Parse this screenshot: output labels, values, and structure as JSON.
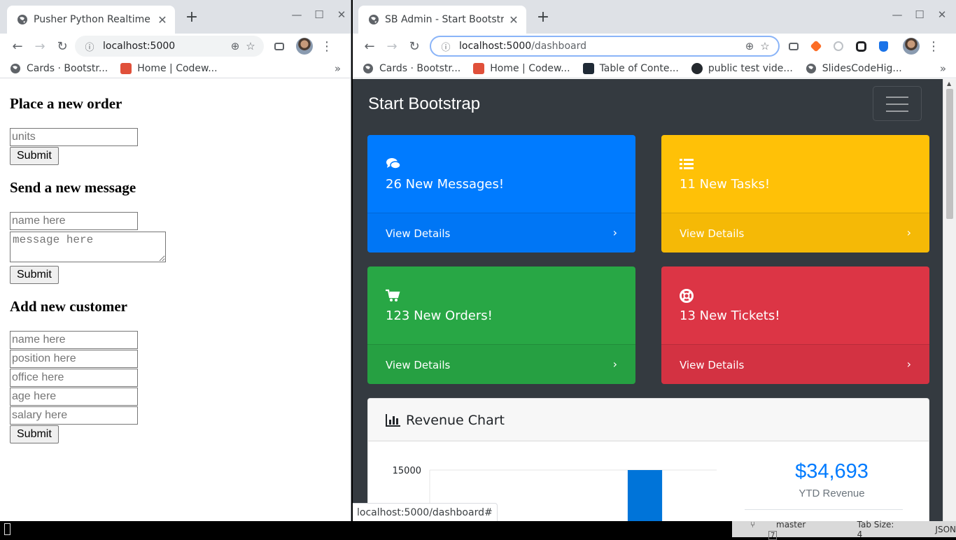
{
  "left_window": {
    "tab_title": "Pusher Python Realtime D",
    "url": "localhost:5000",
    "bookmarks": [
      "Cards · Bootstr...",
      "Home | Codew..."
    ],
    "bookmarks_more": "»",
    "form_order": {
      "heading": "Place a new order",
      "units_placeholder": "units",
      "submit": "Submit"
    },
    "form_message": {
      "heading": "Send a new message",
      "name_placeholder": "name here",
      "message_placeholder": "message here",
      "submit": "Submit"
    },
    "form_customer": {
      "heading": "Add new customer",
      "name_placeholder": "name here",
      "position_placeholder": "position here",
      "office_placeholder": "office here",
      "age_placeholder": "age here",
      "salary_placeholder": "salary here",
      "submit": "Submit"
    }
  },
  "right_window": {
    "tab_title": "SB Admin - Start Bootstrap",
    "url_host": "localhost:5000",
    "url_path": "/dashboard",
    "bookmarks": [
      "Cards · Bootstr...",
      "Home | Codew...",
      "Table of Conte...",
      "public test vide...",
      "SlidesCodeHig..."
    ],
    "bookmarks_more": "»",
    "brand": "Start Bootstrap",
    "cards": [
      {
        "text": "26 New Messages!",
        "footer": "View Details",
        "icon": "comments-icon",
        "color": "#007bff"
      },
      {
        "text": "11 New Tasks!",
        "footer": "View Details",
        "icon": "list-icon",
        "color": "#ffc107"
      },
      {
        "text": "123 New Orders!",
        "footer": "View Details",
        "icon": "shopping-cart-icon",
        "color": "#28a745"
      },
      {
        "text": "13 New Tickets!",
        "footer": "View Details",
        "icon": "life-ring-icon",
        "color": "#dc3545"
      }
    ],
    "chevron": "›",
    "revenue": {
      "title": "Revenue Chart",
      "ytd_amount": "$34,693",
      "ytd_label": "YTD Revenue"
    },
    "status_url": "localhost:5000/dashboard#"
  },
  "chart_data": {
    "type": "bar",
    "y_tick_labels": [
      "15000"
    ],
    "values_visible": [
      {
        "index": 0,
        "value": 0
      },
      {
        "index": 1,
        "value": 0
      },
      {
        "index": 2,
        "value": 0
      },
      {
        "index": 3,
        "value": 300
      },
      {
        "index": 4,
        "value": 15000
      },
      {
        "index": 5,
        "value": 0
      }
    ],
    "ylim": [
      0,
      15000
    ],
    "bar_color": "#0074d9"
  },
  "editor_status": {
    "branch": "master",
    "branch_badge": "7",
    "tab_size": "Tab Size: 4",
    "syntax": "JSON"
  },
  "colors": {
    "dashboard_bg": "#343a40",
    "primary": "#007bff",
    "warning": "#ffc107",
    "success": "#28a745",
    "danger": "#dc3545"
  }
}
